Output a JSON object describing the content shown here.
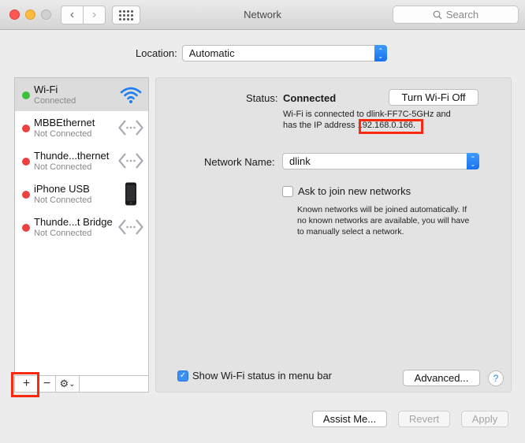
{
  "window": {
    "title": "Network",
    "search_placeholder": "Search"
  },
  "location": {
    "label": "Location:",
    "value": "Automatic"
  },
  "services": [
    {
      "name": "Wi-Fi",
      "status": "Connected",
      "status_color": "#3cc03c",
      "icon": "wifi-icon",
      "selected": true
    },
    {
      "name": "MBBEthernet",
      "status": "Not Connected",
      "status_color": "#ec4141",
      "icon": "ethernet-icon",
      "selected": false
    },
    {
      "name": "Thunde...thernet",
      "status": "Not Connected",
      "status_color": "#ec4141",
      "icon": "ethernet-icon",
      "selected": false
    },
    {
      "name": "iPhone USB",
      "status": "Not Connected",
      "status_color": "#ec4141",
      "icon": "iphone-icon",
      "selected": false
    },
    {
      "name": "Thunde...t Bridge",
      "status": "Not Connected",
      "status_color": "#ec4141",
      "icon": "ethernet-icon",
      "selected": false
    }
  ],
  "sidebar_toolbar": {
    "add": "+",
    "remove": "−",
    "gear": "⚙",
    "gear_chevron": "⌄"
  },
  "detail": {
    "status_label": "Status:",
    "status_value": "Connected",
    "turn_off_button": "Turn Wi-Fi Off",
    "status_desc_line1": "Wi-Fi is connected to dlink-FF7C-5GHz and",
    "status_desc_line2_prefix": "has the IP address ",
    "ip_address": "192.168.0.166.",
    "network_name_label": "Network Name:",
    "network_name_value": "dlink",
    "ask_join_label": "Ask to join new networks",
    "ask_join_checked": false,
    "ask_join_desc_line1": "Known networks will be joined automatically. If",
    "ask_join_desc_line2": "no known networks are available, you will have",
    "ask_join_desc_line3": "to manually select a network.",
    "show_status_label": "Show Wi-Fi status in menu bar",
    "show_status_checked": true,
    "advanced_button": "Advanced...",
    "help_button": "?"
  },
  "footer": {
    "assist_button": "Assist Me...",
    "revert_button": "Revert",
    "apply_button": "Apply"
  },
  "highlight_color": "#fa2a10"
}
